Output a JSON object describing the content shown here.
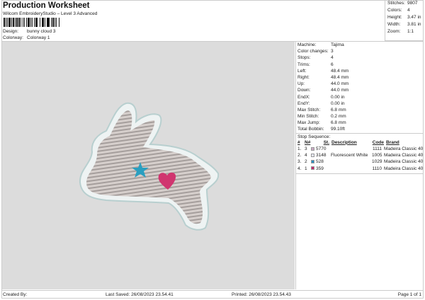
{
  "header": {
    "title": "Production Worksheet",
    "subtitle": "Wilcom EmbroideryStudio – Level 3 Advanced",
    "design_label": "Design:",
    "design_value": "bunny cloud 3",
    "colorway_label": "Colorway:",
    "colorway_value": "Colorway 1"
  },
  "stats": [
    {
      "k": "Stitches:",
      "v": "9807"
    },
    {
      "k": "Colors:",
      "v": "4"
    },
    {
      "k": "Height:",
      "v": "3.47 in"
    },
    {
      "k": "Width:",
      "v": "3.81 in"
    },
    {
      "k": "Zoom:",
      "v": "1:1"
    }
  ],
  "details": [
    {
      "k": "Machine:",
      "v": "Tajima"
    },
    {
      "k": "Color changes:",
      "v": "3"
    },
    {
      "k": "Stops:",
      "v": "4"
    },
    {
      "k": "Trims:",
      "v": "6"
    },
    {
      "k": "Left:",
      "v": "48.4 mm"
    },
    {
      "k": "Right:",
      "v": "48.4 mm"
    },
    {
      "k": "Up:",
      "v": "44.0 mm"
    },
    {
      "k": "Down:",
      "v": "44.0 mm"
    },
    {
      "k": "EndX:",
      "v": "0.00 in"
    },
    {
      "k": "EndY:",
      "v": "0.00 in"
    },
    {
      "k": "Max Stitch:",
      "v": "6.8 mm"
    },
    {
      "k": "Min Stitch:",
      "v": "0.2 mm"
    },
    {
      "k": "Max Jump:",
      "v": "6.8 mm"
    },
    {
      "k": "Total Bobbin:",
      "v": "99.10ft"
    }
  ],
  "stop_sequence": {
    "title": "Stop Sequence:",
    "headers": {
      "num": "#",
      "n": "N#",
      "st": "St.",
      "desc": "Description",
      "code": "Code",
      "brand": "Brand"
    },
    "rows": [
      {
        "num": "1.",
        "n": "3",
        "color": "#c9a9c4",
        "st": "5770",
        "desc": "",
        "code": "1111",
        "brand": "Madeira Classic 40"
      },
      {
        "num": "2.",
        "n": "4",
        "color": "#e6e8f6",
        "st": "3148",
        "desc": "Fluorescent White",
        "code": "1005",
        "brand": "Madeira Classic 40"
      },
      {
        "num": "3.",
        "n": "2",
        "color": "#2a8fc0",
        "st": "528",
        "desc": "",
        "code": "1029",
        "brand": "Madeira Classic 40"
      },
      {
        "num": "4.",
        "n": "1",
        "color": "#c2286a",
        "st": "359",
        "desc": "",
        "code": "1110",
        "brand": "Madeira Classic 40"
      }
    ]
  },
  "footer": {
    "created_by": "Created By:",
    "last_saved": "Last Saved: 26/08/2023 23.54.41",
    "printed": "Printed: 26/08/2023 23.54.43",
    "page": "Page 1 of 1"
  }
}
